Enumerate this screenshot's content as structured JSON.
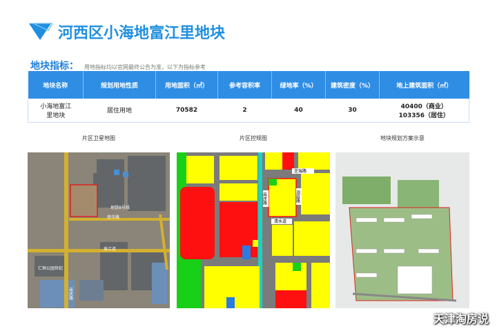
{
  "title": "河西区小海地富江里地块",
  "indicators": {
    "label": "地块指标：",
    "note": "用地指标均以官网最终公告为准，以下为指标参考"
  },
  "table": {
    "headers": [
      "地块名称",
      "规划用地性质",
      "用地面积（㎡）",
      "参考容积率",
      "绿地率（%）",
      "建筑密度（%）",
      "地上建筑面积（㎡）"
    ],
    "row": {
      "name": "小海地富江里地块",
      "use": "居住用地",
      "area": "70582",
      "far": "2",
      "green": "40",
      "density": "30",
      "gfa_commercial": "40400（商业）",
      "gfa_residential": "103356（居住）"
    }
  },
  "captions": {
    "satellite": "片区卫星地图",
    "plan": "片区控规图",
    "scheme": "地块规划方案示意"
  },
  "satellite_labels": {
    "road_a": "南庆路",
    "road_b": "地铁8号线",
    "road_c": "南华路",
    "road_d": "珠江道",
    "park": "仁恒公园世纪"
  },
  "plan_labels": {
    "road_a": "芝瑞路",
    "road_b": "洞庭路",
    "road_c": "南庆路",
    "road_d": "清水道"
  },
  "watermark": "天津淘房说",
  "colors": {
    "accent": "#2f8de4",
    "title": "#1f8fe0",
    "parcel": "#e02020"
  }
}
